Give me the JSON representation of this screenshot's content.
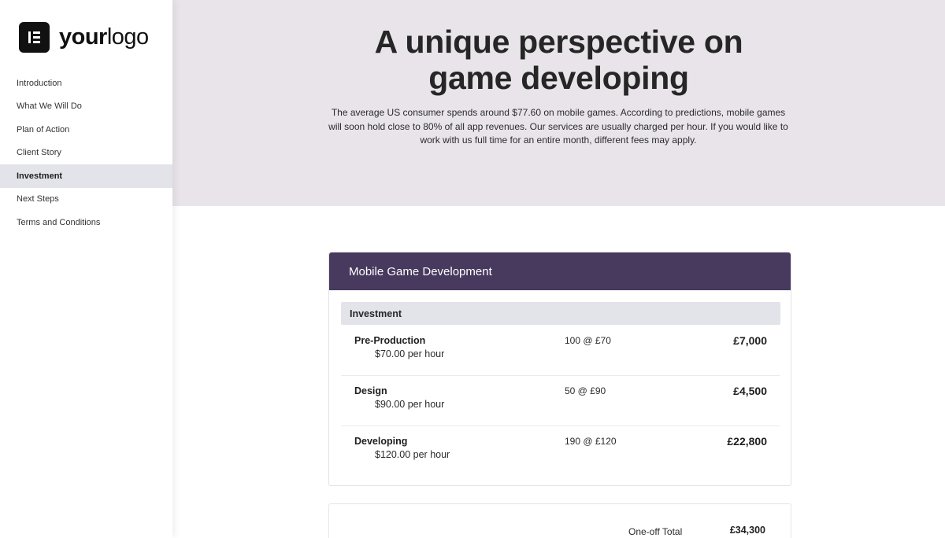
{
  "brand": {
    "logo_text_bold": "your",
    "logo_text_regular": "logo"
  },
  "nav": {
    "items": [
      {
        "label": "Introduction"
      },
      {
        "label": "What We Will Do"
      },
      {
        "label": "Plan of Action"
      },
      {
        "label": "Client Story"
      },
      {
        "label": "Investment",
        "active": true
      },
      {
        "label": "Next Steps"
      },
      {
        "label": "Terms and Conditions"
      }
    ]
  },
  "hero": {
    "title_line1": "A unique perspective on",
    "title_line2": "game developing",
    "description": "The average US consumer spends around $77.60 on mobile games. According to predictions, mobile games will soon hold close to 80% of all app revenues. Our services are usually charged per hour. If you would like to work with us full time for an entire month, different fees may apply."
  },
  "pricing": {
    "title": "Mobile Game Development",
    "section": "Investment",
    "items": [
      {
        "name": "Pre-Production",
        "rate": "$70.00 per hour",
        "qty": "100 @ £70",
        "amount": "£7,000"
      },
      {
        "name": "Design",
        "rate": "$90.00 per hour",
        "qty": "50 @ £90",
        "amount": "£4,500"
      },
      {
        "name": "Developing",
        "rate": "$120.00 per hour",
        "qty": "190 @ £120",
        "amount": "£22,800"
      }
    ],
    "total_label": "One-off Total",
    "total_value": "£34,300"
  },
  "colors": {
    "header_purple": "#483a5e",
    "hero_bg": "#e8e4ea",
    "active_nav_bg": "#e2e4ea"
  }
}
